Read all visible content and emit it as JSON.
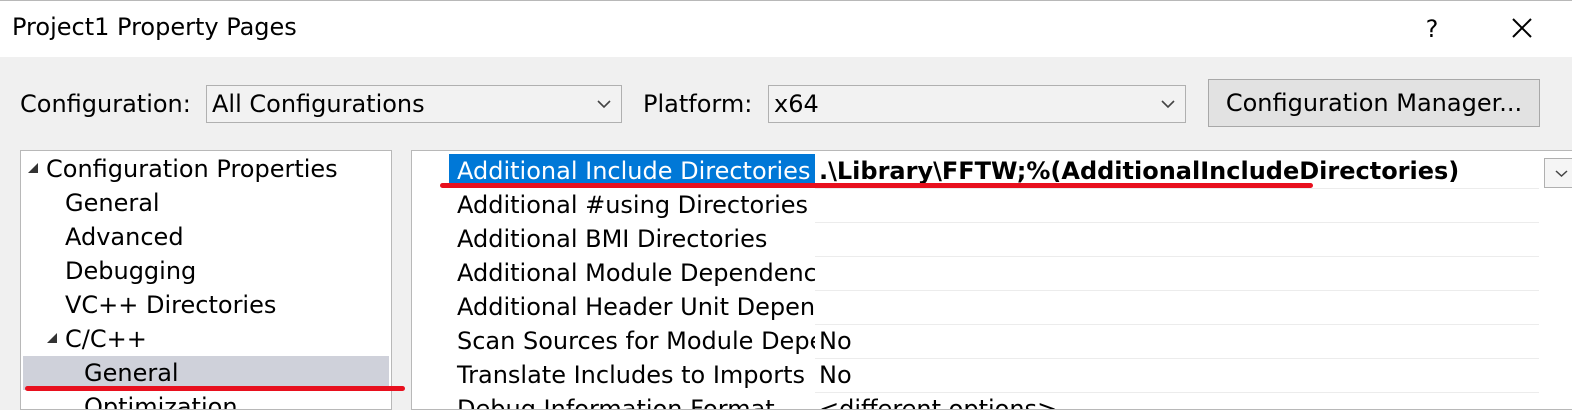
{
  "window": {
    "title": "Project1 Property Pages",
    "help_label": "?"
  },
  "config_bar": {
    "configuration_label": "Configuration:",
    "configuration_value": "All Configurations",
    "platform_label": "Platform:",
    "platform_value": "x64",
    "manager_button": "Configuration Manager..."
  },
  "tree": {
    "root": "Configuration Properties",
    "general": "General",
    "advanced": "Advanced",
    "debugging": "Debugging",
    "vc_directories": "VC++ Directories",
    "cpp": "C/C++",
    "cpp_general": "General",
    "optimization": "Optimization"
  },
  "properties": [
    {
      "name": "Additional Include Directories",
      "value": ".\\Library\\FFTW;%(AdditionalIncludeDirectories)"
    },
    {
      "name": "Additional #using Directories",
      "value": ""
    },
    {
      "name": "Additional BMI Directories",
      "value": ""
    },
    {
      "name": "Additional Module Dependencies",
      "value": ""
    },
    {
      "name": "Additional Header Unit Dependencies",
      "value": ""
    },
    {
      "name": "Scan Sources for Module Dependencies",
      "value": "No"
    },
    {
      "name": "Translate Includes to Imports",
      "value": "No"
    },
    {
      "name": "Debug Information Format",
      "value": "<different options>"
    }
  ],
  "colors": {
    "selection": "#0078d7",
    "tree_selection": "#cfd1da",
    "annotation": "#e8101e"
  }
}
